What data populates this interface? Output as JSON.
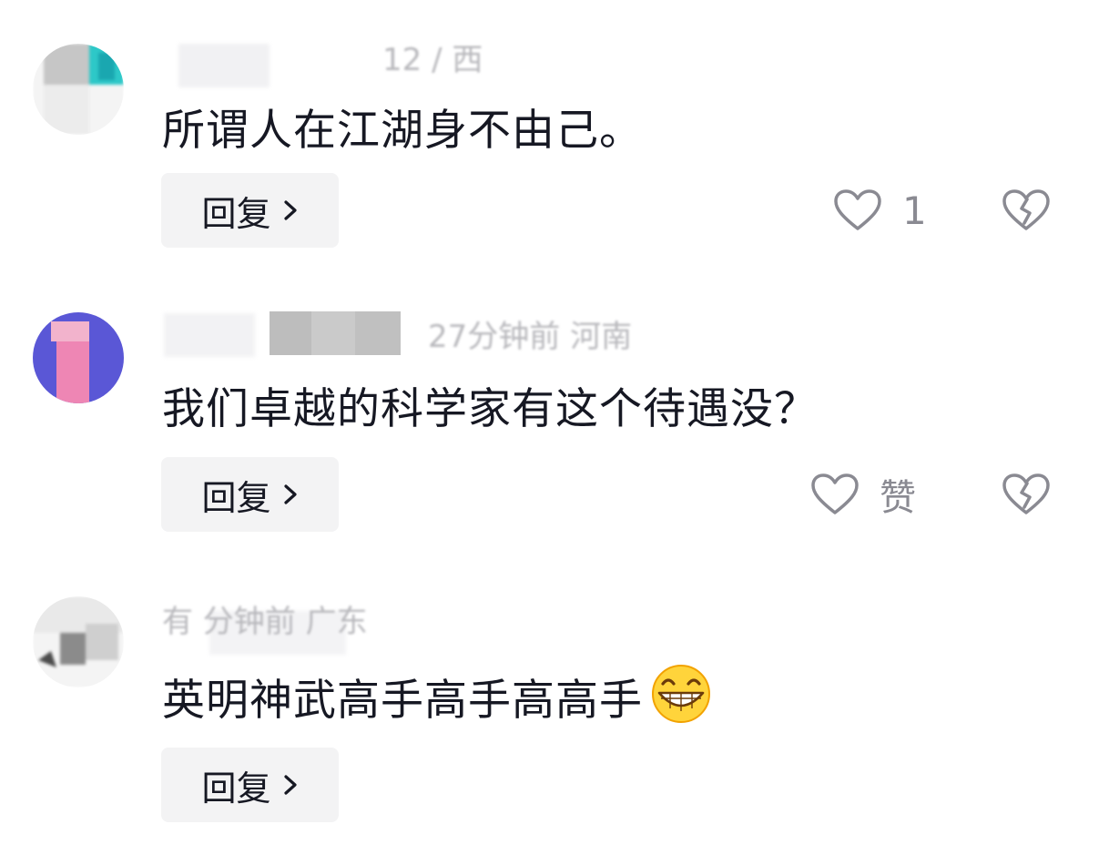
{
  "comments": [
    {
      "meta_text": "12 / 西",
      "text": "所谓人在江湖身不由己。",
      "reply_label": "回复",
      "like_count": "1",
      "has_actions": true
    },
    {
      "meta_text": "27分钟前 河南",
      "text": "我们卓越的科学家有这个待遇没？",
      "reply_label": "回复",
      "like_count": "赞",
      "has_actions": true
    },
    {
      "meta_text": "有 分钟前 广东",
      "text": "英明神武高手高手高高手",
      "text_emoji": "grinning-emoji",
      "reply_label": "回复",
      "has_actions": false
    }
  ],
  "colors": {
    "text": "#161823",
    "meta": "#b8b8bc",
    "icon": "#8a8a92",
    "reply_bg": "#f3f3f4",
    "avatar2_purple": "#5a57d6",
    "avatar2_pink": "#ee86b4"
  },
  "icons": {
    "like": "heart-outline-icon",
    "dislike": "broken-heart-icon",
    "reply": "chevron-right-icon"
  }
}
